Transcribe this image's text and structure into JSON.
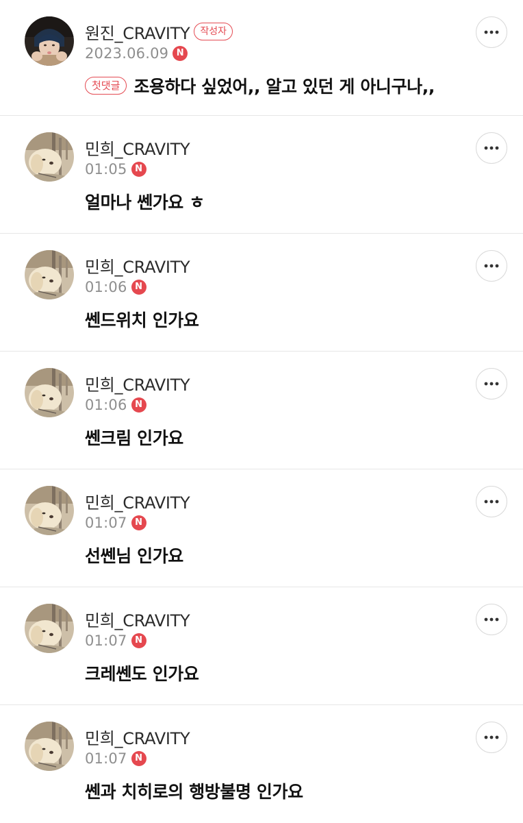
{
  "comments": [
    {
      "author": "원진_CRAVITY",
      "author_badge": "작성자",
      "time": "2023.06.09",
      "new_badge": "N",
      "tag": "첫댓글",
      "text": "조용하다 싶었어,, 알고 있던 게 아니구나,,"
    },
    {
      "author": "민희_CRAVITY",
      "time": "01:05",
      "new_badge": "N",
      "text": "얼마나 쎈가요 ㅎ"
    },
    {
      "author": "민희_CRAVITY",
      "time": "01:06",
      "new_badge": "N",
      "text": "쎈드위치 인가요"
    },
    {
      "author": "민희_CRAVITY",
      "time": "01:06",
      "new_badge": "N",
      "text": "쎈크림 인가요"
    },
    {
      "author": "민희_CRAVITY",
      "time": "01:07",
      "new_badge": "N",
      "text": "선쎈님 인가요"
    },
    {
      "author": "민희_CRAVITY",
      "time": "01:07",
      "new_badge": "N",
      "text": "크레쎈도 인가요"
    },
    {
      "author": "민희_CRAVITY",
      "time": "01:07",
      "new_badge": "N",
      "text": "쎈과 치히로의 행방불명 인가요"
    }
  ],
  "icons": {
    "more": "more-horizontal-icon"
  },
  "colors": {
    "accent_red": "#e44a52",
    "new_badge": "#e5484f",
    "timestamp": "#8e8e8e"
  }
}
